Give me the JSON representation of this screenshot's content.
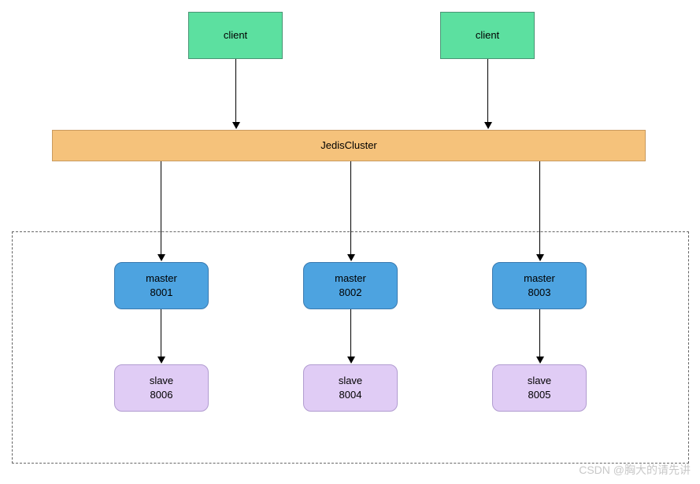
{
  "clients": [
    {
      "label": "client"
    },
    {
      "label": "client"
    }
  ],
  "cluster": {
    "label": "JedisCluster"
  },
  "masters": [
    {
      "label": "master",
      "port": "8001"
    },
    {
      "label": "master",
      "port": "8002"
    },
    {
      "label": "master",
      "port": "8003"
    }
  ],
  "slaves": [
    {
      "label": "slave",
      "port": "8006"
    },
    {
      "label": "slave",
      "port": "8004"
    },
    {
      "label": "slave",
      "port": "8005"
    }
  ],
  "watermark": "CSDN @胸大的请先讲"
}
